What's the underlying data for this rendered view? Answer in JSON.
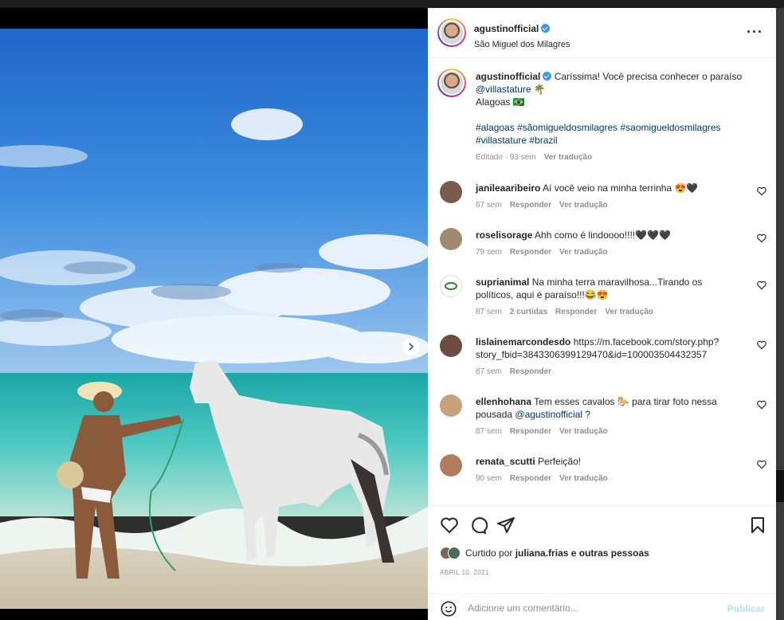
{
  "post": {
    "username": "agustinofficial",
    "location": "São Miguel dos Milagres",
    "more_icon": "more-horizontal-icon",
    "carousel_dots": 3,
    "active_dot": 0
  },
  "caption": {
    "username": "agustinofficial",
    "text": "Caríssima! Você precisa conhecer o paraíso",
    "mention": "@villastature",
    "mention_suffix": " 🌴",
    "line2": "Alagoas 🇧🇷",
    "hashtags": [
      "#alagoas",
      "#sãomigueldosmilagres",
      "#saomigueldosmilagres",
      "#villastature",
      "#brazil"
    ],
    "edited": "Editado · 93 sem",
    "translate": "Ver tradução"
  },
  "comments": [
    {
      "username": "janileaaribeiro",
      "text": "Aí você veio na minha terrinha 😍🖤",
      "time": "67 sem",
      "reply": "Responder",
      "likes": "",
      "translate": "Ver tradução",
      "avatar_color": "#7a5a4a"
    },
    {
      "username": "roselisorage",
      "text": "Ahh como é lindoooo!!!!🖤🖤🖤",
      "time": "79 sem",
      "reply": "Responder",
      "likes": "",
      "translate": "Ver tradução",
      "avatar_color": "#a08a70"
    },
    {
      "username": "suprianimal",
      "text": "Na minha terra maravilhosa...Tirando os políticos, aqui é paraíso!!!😂😍",
      "time": "87 sem",
      "reply": "Responder",
      "likes": "2 curtidas",
      "translate": "Ver tradução",
      "avatar_color": "#2e7d32"
    },
    {
      "username": "lislainemarcondesdo",
      "text": "https://m.facebook.com/story.php?story_fbid=3843306399129470&id=100003504432357",
      "time": "87 sem",
      "reply": "Responder",
      "likes": "",
      "translate": "",
      "avatar_color": "#6d4c41"
    },
    {
      "username": "ellenhohana",
      "text": "Tem esses cavalos 🐎 para tirar foto nessa pousada",
      "mention": "@agustinofficial",
      "text_after": " ?",
      "time": "87 sem",
      "reply": "Responder",
      "likes": "",
      "translate": "Ver tradução",
      "avatar_color": "#c8a27a"
    },
    {
      "username": "renata_scutti",
      "text": "Perfeição!",
      "time": "90 sem",
      "reply": "Responder",
      "likes": "",
      "translate": "Ver tradução",
      "avatar_color": "#b07c5c"
    }
  ],
  "actions": {
    "like_icon": "heart-icon",
    "comment_icon": "comment-icon",
    "share_icon": "paper-plane-icon",
    "save_icon": "bookmark-icon",
    "liked_by_prefix": "Curtido por",
    "liked_by_user": "juliana.frias",
    "liked_by_suffix": "e outras pessoas",
    "date": "ABRIL 10, 2021"
  },
  "add_comment": {
    "placeholder": "Adicione um comentário...",
    "publish": "Publicar",
    "emoji_icon": "smiley-icon"
  }
}
